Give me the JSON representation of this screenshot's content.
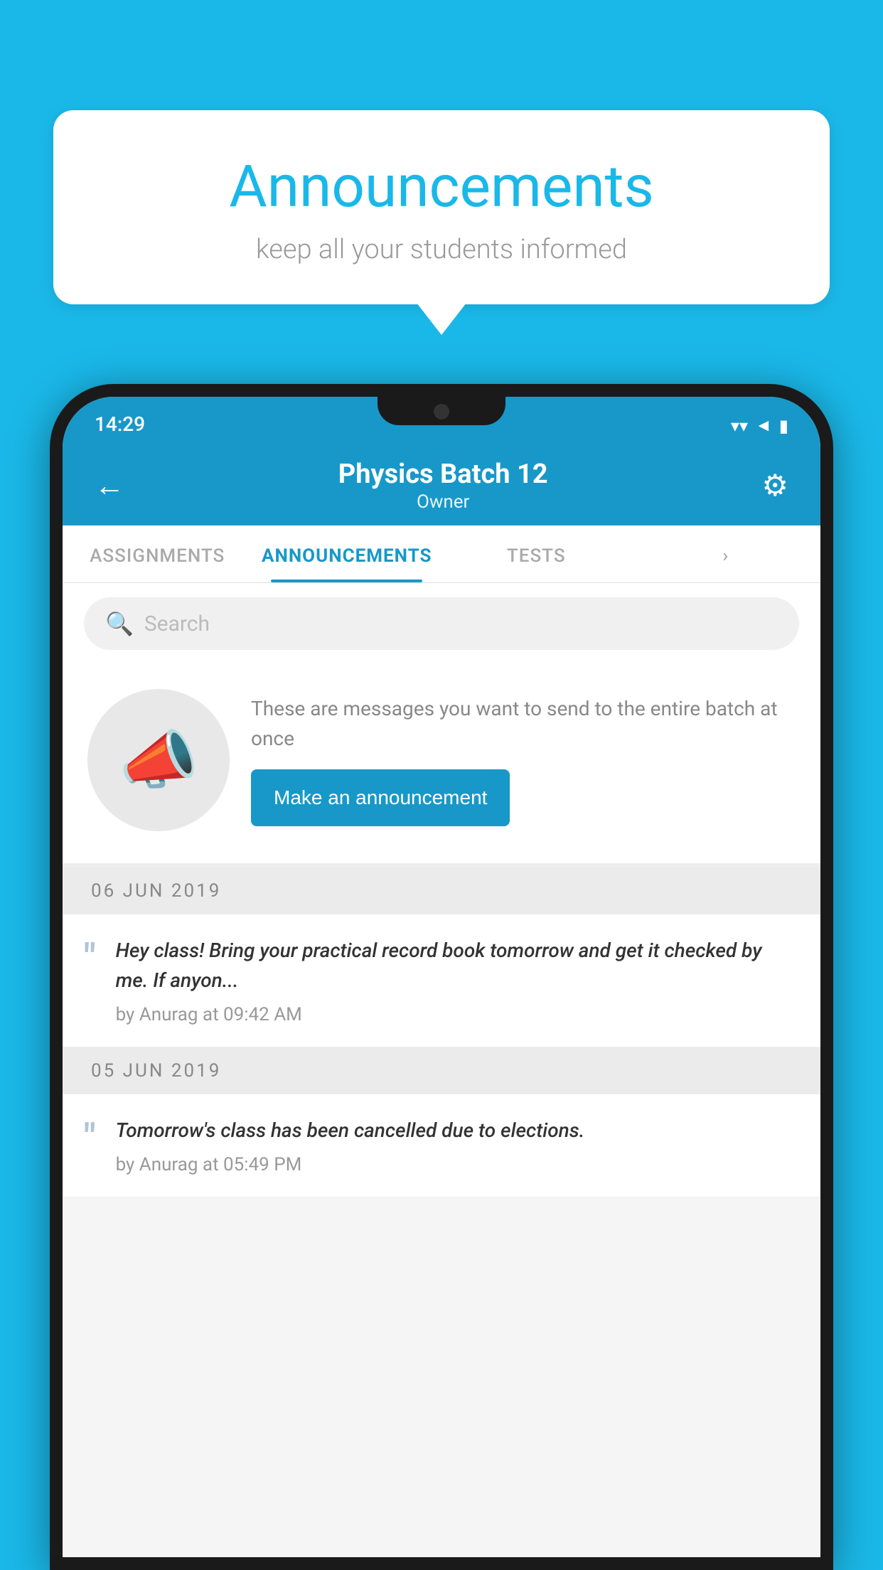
{
  "bubble": {
    "title": "Announcements",
    "subtitle": "keep all your students informed"
  },
  "statusBar": {
    "time": "14:29",
    "wifiIcon": "▾",
    "signalIcon": "◄",
    "batteryIcon": "▮"
  },
  "header": {
    "title": "Physics Batch 12",
    "subtitle": "Owner",
    "backIcon": "←",
    "gearIcon": "⚙"
  },
  "tabs": [
    {
      "label": "ASSIGNMENTS",
      "active": false
    },
    {
      "label": "ANNOUNCEMENTS",
      "active": true
    },
    {
      "label": "TESTS",
      "active": false
    },
    {
      "label": "›",
      "active": false
    }
  ],
  "search": {
    "placeholder": "Search"
  },
  "promptSection": {
    "descriptionText": "These are messages you want to send to the entire batch at once",
    "buttonLabel": "Make an announcement"
  },
  "dateSections": [
    {
      "date": "06  JUN  2019",
      "announcements": [
        {
          "text": "Hey class! Bring your practical record book tomorrow and get it checked by me. If anyon...",
          "author": "by Anurag at 09:42 AM"
        }
      ]
    },
    {
      "date": "05  JUN  2019",
      "announcements": [
        {
          "text": "Tomorrow's class has been cancelled due to elections.",
          "author": "by Anurag at 05:49 PM"
        }
      ]
    }
  ],
  "colors": {
    "accent": "#1898c8",
    "background": "#1ab8e8",
    "white": "#ffffff"
  }
}
